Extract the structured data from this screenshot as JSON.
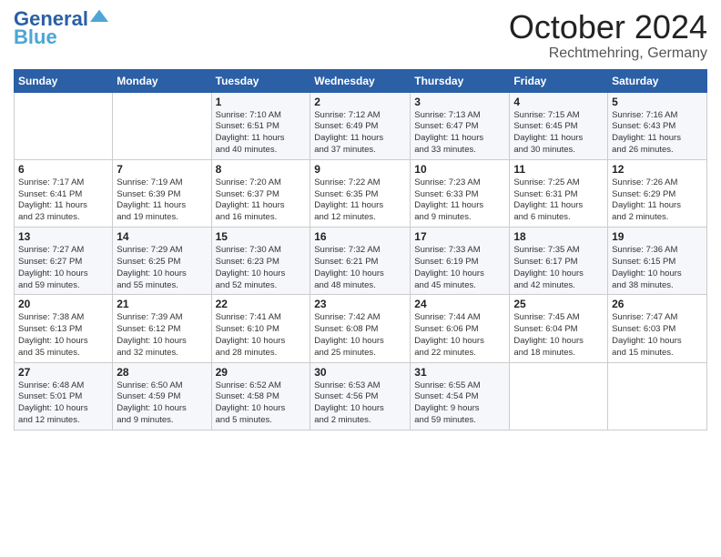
{
  "header": {
    "logo_line1": "General",
    "logo_line2": "Blue",
    "title": "October 2024",
    "subtitle": "Rechtmehring, Germany"
  },
  "days_of_week": [
    "Sunday",
    "Monday",
    "Tuesday",
    "Wednesday",
    "Thursday",
    "Friday",
    "Saturday"
  ],
  "weeks": [
    [
      {
        "day": "",
        "info": ""
      },
      {
        "day": "",
        "info": ""
      },
      {
        "day": "1",
        "info": "Sunrise: 7:10 AM\nSunset: 6:51 PM\nDaylight: 11 hours\nand 40 minutes."
      },
      {
        "day": "2",
        "info": "Sunrise: 7:12 AM\nSunset: 6:49 PM\nDaylight: 11 hours\nand 37 minutes."
      },
      {
        "day": "3",
        "info": "Sunrise: 7:13 AM\nSunset: 6:47 PM\nDaylight: 11 hours\nand 33 minutes."
      },
      {
        "day": "4",
        "info": "Sunrise: 7:15 AM\nSunset: 6:45 PM\nDaylight: 11 hours\nand 30 minutes."
      },
      {
        "day": "5",
        "info": "Sunrise: 7:16 AM\nSunset: 6:43 PM\nDaylight: 11 hours\nand 26 minutes."
      }
    ],
    [
      {
        "day": "6",
        "info": "Sunrise: 7:17 AM\nSunset: 6:41 PM\nDaylight: 11 hours\nand 23 minutes."
      },
      {
        "day": "7",
        "info": "Sunrise: 7:19 AM\nSunset: 6:39 PM\nDaylight: 11 hours\nand 19 minutes."
      },
      {
        "day": "8",
        "info": "Sunrise: 7:20 AM\nSunset: 6:37 PM\nDaylight: 11 hours\nand 16 minutes."
      },
      {
        "day": "9",
        "info": "Sunrise: 7:22 AM\nSunset: 6:35 PM\nDaylight: 11 hours\nand 12 minutes."
      },
      {
        "day": "10",
        "info": "Sunrise: 7:23 AM\nSunset: 6:33 PM\nDaylight: 11 hours\nand 9 minutes."
      },
      {
        "day": "11",
        "info": "Sunrise: 7:25 AM\nSunset: 6:31 PM\nDaylight: 11 hours\nand 6 minutes."
      },
      {
        "day": "12",
        "info": "Sunrise: 7:26 AM\nSunset: 6:29 PM\nDaylight: 11 hours\nand 2 minutes."
      }
    ],
    [
      {
        "day": "13",
        "info": "Sunrise: 7:27 AM\nSunset: 6:27 PM\nDaylight: 10 hours\nand 59 minutes."
      },
      {
        "day": "14",
        "info": "Sunrise: 7:29 AM\nSunset: 6:25 PM\nDaylight: 10 hours\nand 55 minutes."
      },
      {
        "day": "15",
        "info": "Sunrise: 7:30 AM\nSunset: 6:23 PM\nDaylight: 10 hours\nand 52 minutes."
      },
      {
        "day": "16",
        "info": "Sunrise: 7:32 AM\nSunset: 6:21 PM\nDaylight: 10 hours\nand 48 minutes."
      },
      {
        "day": "17",
        "info": "Sunrise: 7:33 AM\nSunset: 6:19 PM\nDaylight: 10 hours\nand 45 minutes."
      },
      {
        "day": "18",
        "info": "Sunrise: 7:35 AM\nSunset: 6:17 PM\nDaylight: 10 hours\nand 42 minutes."
      },
      {
        "day": "19",
        "info": "Sunrise: 7:36 AM\nSunset: 6:15 PM\nDaylight: 10 hours\nand 38 minutes."
      }
    ],
    [
      {
        "day": "20",
        "info": "Sunrise: 7:38 AM\nSunset: 6:13 PM\nDaylight: 10 hours\nand 35 minutes."
      },
      {
        "day": "21",
        "info": "Sunrise: 7:39 AM\nSunset: 6:12 PM\nDaylight: 10 hours\nand 32 minutes."
      },
      {
        "day": "22",
        "info": "Sunrise: 7:41 AM\nSunset: 6:10 PM\nDaylight: 10 hours\nand 28 minutes."
      },
      {
        "day": "23",
        "info": "Sunrise: 7:42 AM\nSunset: 6:08 PM\nDaylight: 10 hours\nand 25 minutes."
      },
      {
        "day": "24",
        "info": "Sunrise: 7:44 AM\nSunset: 6:06 PM\nDaylight: 10 hours\nand 22 minutes."
      },
      {
        "day": "25",
        "info": "Sunrise: 7:45 AM\nSunset: 6:04 PM\nDaylight: 10 hours\nand 18 minutes."
      },
      {
        "day": "26",
        "info": "Sunrise: 7:47 AM\nSunset: 6:03 PM\nDaylight: 10 hours\nand 15 minutes."
      }
    ],
    [
      {
        "day": "27",
        "info": "Sunrise: 6:48 AM\nSunset: 5:01 PM\nDaylight: 10 hours\nand 12 minutes."
      },
      {
        "day": "28",
        "info": "Sunrise: 6:50 AM\nSunset: 4:59 PM\nDaylight: 10 hours\nand 9 minutes."
      },
      {
        "day": "29",
        "info": "Sunrise: 6:52 AM\nSunset: 4:58 PM\nDaylight: 10 hours\nand 5 minutes."
      },
      {
        "day": "30",
        "info": "Sunrise: 6:53 AM\nSunset: 4:56 PM\nDaylight: 10 hours\nand 2 minutes."
      },
      {
        "day": "31",
        "info": "Sunrise: 6:55 AM\nSunset: 4:54 PM\nDaylight: 9 hours\nand 59 minutes."
      },
      {
        "day": "",
        "info": ""
      },
      {
        "day": "",
        "info": ""
      }
    ]
  ]
}
